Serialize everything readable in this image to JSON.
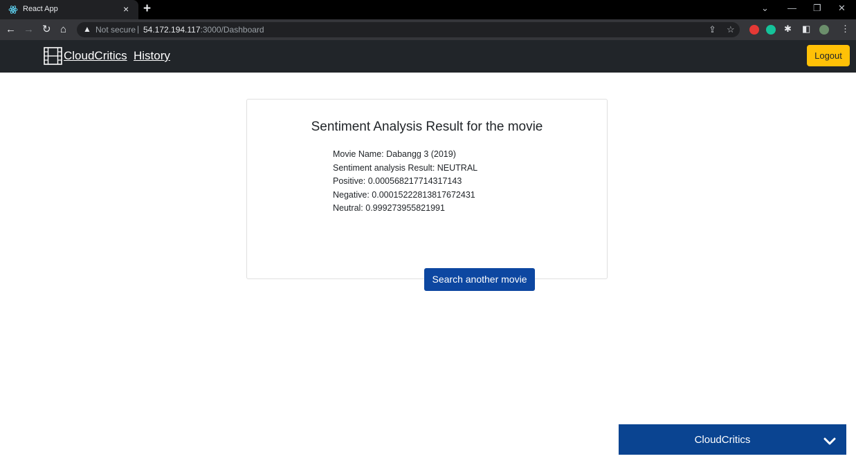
{
  "browser": {
    "tab_title": "React App",
    "url_warning": "Not secure",
    "url_host": "54.172.194.117",
    "url_path": ":3000/Dashboard"
  },
  "navbar": {
    "brand": "CloudCritics",
    "history": "History",
    "logout": "Logout"
  },
  "result": {
    "title": "Sentiment Analysis Result for the movie",
    "movie_name": "Movie Name: Dabangg 3 (2019)",
    "sentiment": "Sentiment analysis Result: NEUTRAL",
    "positive": "Positive: 0.000568217714317143",
    "negative": "Negative: 0.00015222813817672431",
    "neutral": "Neutral: 0.999273955821991",
    "button": "Search another movie"
  },
  "chat": {
    "title": "CloudCritics"
  },
  "icons": {
    "brand": "film-icon",
    "chat_toggle": "chevron-down-icon"
  },
  "colors": {
    "navbar": "#212529",
    "logout": "#ffc107",
    "primary_button": "#0d47a1",
    "chat_bar": "#0a4491"
  }
}
